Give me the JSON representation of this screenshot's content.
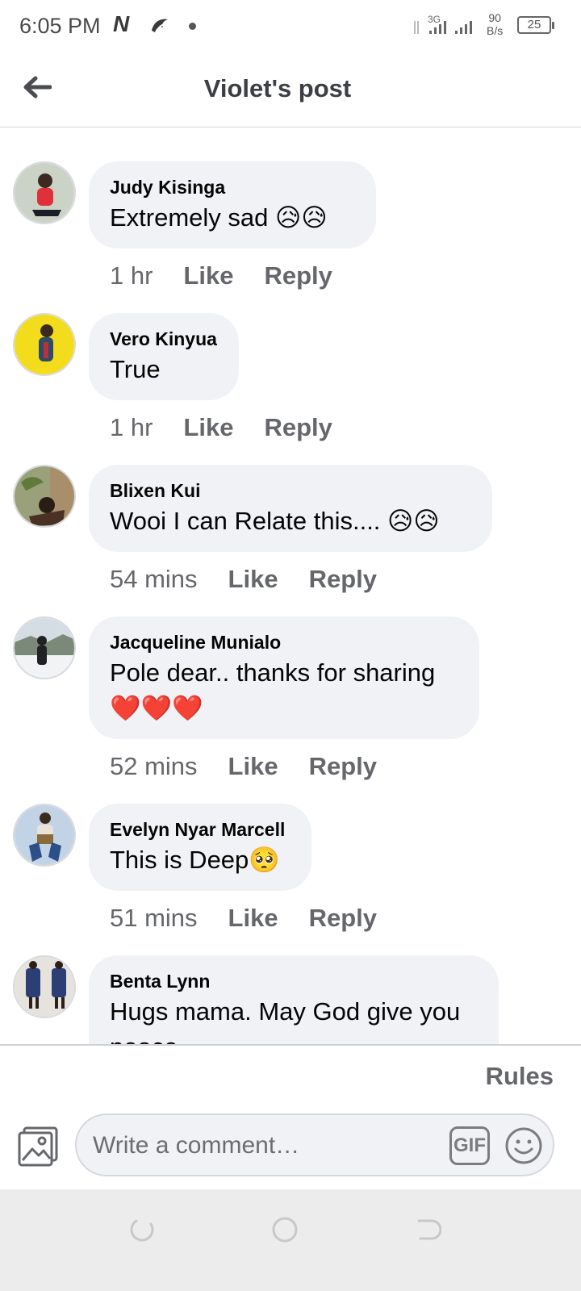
{
  "status_bar": {
    "time": "6:05 PM",
    "carrier_icon_text": "N",
    "network_type": "3G",
    "net_speed_value": "90",
    "net_speed_unit": "B/s",
    "battery": "25"
  },
  "header": {
    "title": "Violet's post"
  },
  "comments": [
    {
      "author": "Judy Kisinga",
      "text": "Extremely sad 😥😥",
      "time": "1 hr",
      "like": "Like",
      "reply": "Reply",
      "avatar_color": "#c8d1c4"
    },
    {
      "author": "Vero Kinyua",
      "text": "True",
      "time": "1 hr",
      "like": "Like",
      "reply": "Reply",
      "avatar_color": "#f2dc1b"
    },
    {
      "author": "Blixen Kui",
      "text": "Wooi I can Relate this.... 😥😥",
      "time": "54 mins",
      "like": "Like",
      "reply": "Reply",
      "avatar_color": "#8a8f6a"
    },
    {
      "author": "Jacqueline Munialo",
      "text": "Pole dear.. thanks for sharing ❤️❤️❤️",
      "time": "52 mins",
      "like": "Like",
      "reply": "Reply",
      "avatar_color": "#c9d2db"
    },
    {
      "author": "Evelyn Nyar Marcell",
      "text": "This is Deep🥺",
      "time": "51 mins",
      "like": "Like",
      "reply": "Reply",
      "avatar_color": "#b7c9e0"
    },
    {
      "author": "Benta Lynn",
      "text": "Hugs mama. May God give you peace",
      "time": "",
      "like": "",
      "reply": "",
      "avatar_color": "#9aa6b9"
    }
  ],
  "footer": {
    "rules": "Rules",
    "compose_placeholder": "Write a comment…",
    "gif_label": "GIF"
  },
  "icons": {
    "back": "arrow-left-icon",
    "photo": "photo-icon",
    "emoji": "smiley-icon",
    "nav_back": "nav-back-icon",
    "nav_home": "nav-home-icon",
    "nav_recent": "nav-recent-icon"
  }
}
